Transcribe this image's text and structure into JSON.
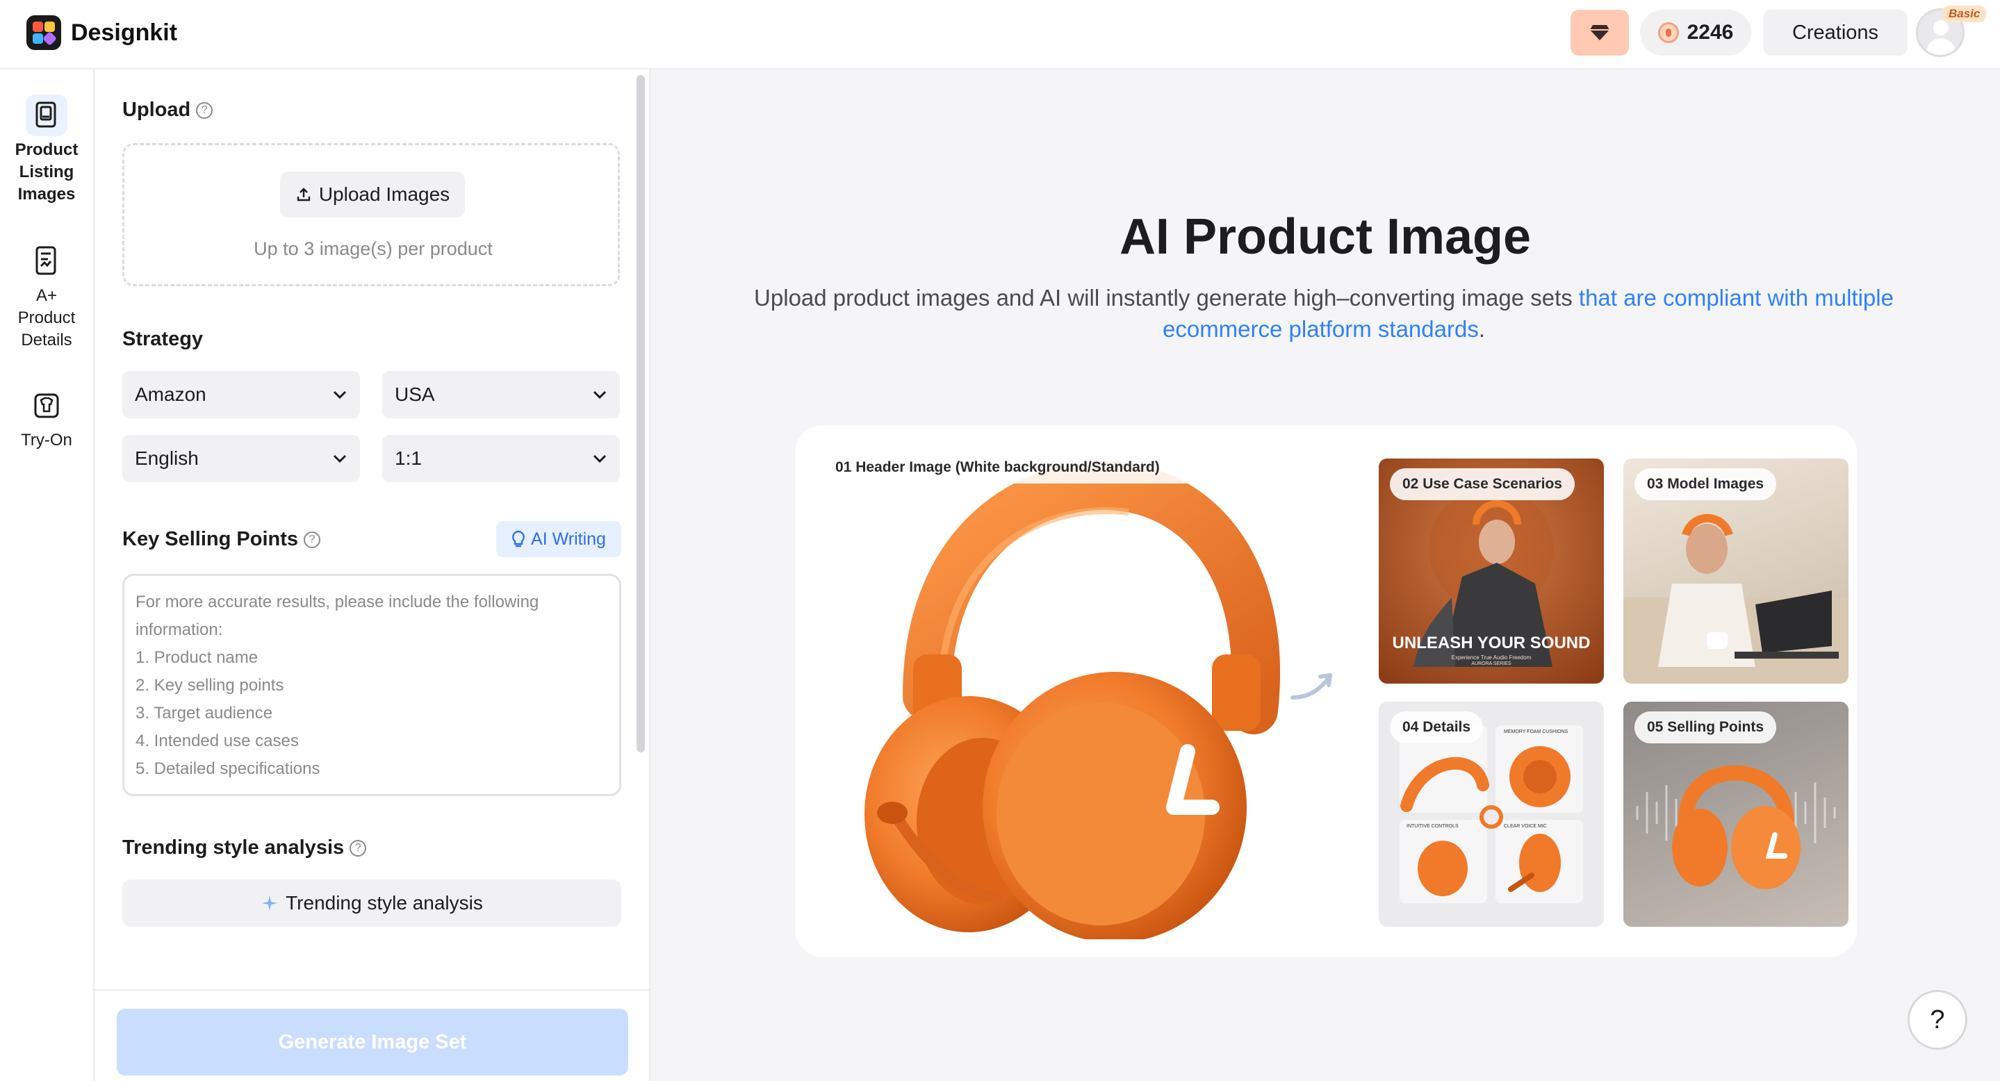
{
  "app": {
    "name": "Designkit"
  },
  "header": {
    "credits": "2246",
    "creations_label": "Creations",
    "plan_badge": "Basic"
  },
  "nav": {
    "items": [
      {
        "label": "Product Listing Images",
        "active": true
      },
      {
        "label": "A+ Product Details",
        "active": false
      },
      {
        "label": "Try-On",
        "active": false
      }
    ]
  },
  "panel": {
    "upload": {
      "title": "Upload",
      "button_label": "Upload Images",
      "hint": "Up to 3 image(s) per product"
    },
    "strategy": {
      "title": "Strategy",
      "platform": "Amazon",
      "country": "USA",
      "language": "English",
      "ratio": "1:1"
    },
    "selling_points": {
      "title": "Key Selling Points",
      "ai_writing_label": "AI Writing",
      "placeholder_lines": [
        "For more accurate results, please include the following",
        "information:",
        "1. Product name",
        "2. Key selling points",
        "3. Target audience",
        "4. Intended use cases",
        "5. Detailed specifications"
      ]
    },
    "trending": {
      "title": "Trending style analysis",
      "button_label": "Trending style analysis"
    },
    "generate_label": "Generate Image Set"
  },
  "main": {
    "title": "AI Product Image",
    "subtitle_plain": "Upload product images and AI will instantly generate high–converting image sets ",
    "subtitle_link": "that are compliant with multiple ecommerce platform standards",
    "subtitle_end": ".",
    "showcase": {
      "header_chip": "01 Header Image (White background/Standard)",
      "tiles": [
        {
          "chip": "02 Use Case Scenarios",
          "overlay": "UNLEASH YOUR SOUND",
          "overlay_sub": "Experience True Audio Freedom",
          "overlay_series": "AURORA SERIES"
        },
        {
          "chip": "03 Model Images"
        },
        {
          "chip": "04 Details",
          "labels": [
            "MEMORY FOAM CUSHIONS",
            "INTUITIVE CONTROLS",
            "CLEAR VOICE MIC"
          ]
        },
        {
          "chip": "05 Selling Points"
        }
      ]
    }
  },
  "help_fab": "?",
  "colors": {
    "accent": "#2f80ff",
    "brand_orange": "#f07a2a",
    "diamond_bg": "#ffc9b3"
  }
}
